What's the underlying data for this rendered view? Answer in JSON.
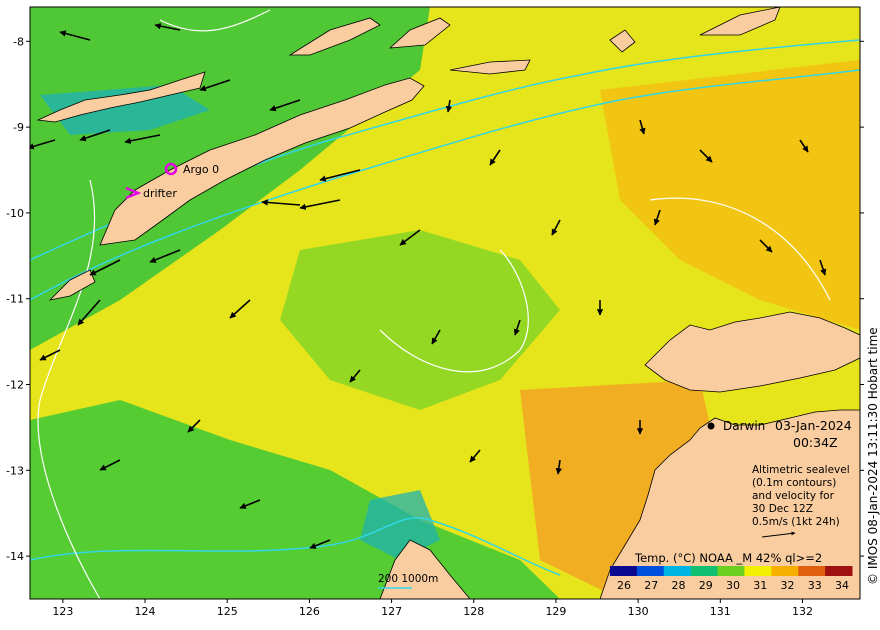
{
  "map": {
    "x_ticks": [
      "123",
      "124",
      "125",
      "126",
      "127",
      "128",
      "129",
      "130",
      "131",
      "132"
    ],
    "y_ticks": [
      "-8",
      "-9",
      "-10",
      "-11",
      "-12",
      "-13",
      "-14"
    ],
    "lon_range": [
      122.6,
      132.7
    ],
    "lat_range": [
      -14.5,
      -7.6
    ],
    "markers": {
      "argo_label": "Argo 0",
      "drifter_label": "drifter"
    },
    "place_label": "Darwin",
    "date_line1": "03-Jan-2024",
    "date_line2": "00:34Z",
    "info": [
      "Altimetric sealevel",
      "(0.1m contours)",
      "and velocity for",
      "30 Dec 12Z",
      "0.5m/s (1kt 24h)"
    ],
    "depth_legend": "200  1000m",
    "credit": "© IMOS 08-Jan-2024 13:11:30 Hobart time",
    "colorbar": {
      "title": "Temp. (°C) NOAA _M 42% ql>=2",
      "ticks": [
        "26",
        "27",
        "28",
        "29",
        "30",
        "31",
        "32",
        "33",
        "34"
      ],
      "colors": [
        "#0a0a90",
        "#0050e0",
        "#00b4e6",
        "#10c070",
        "#6cd020",
        "#f0f000",
        "#f5b000",
        "#e06010",
        "#a01010"
      ]
    },
    "colors": {
      "land": "#f9cda0",
      "sea_mid": "#e6e41a",
      "sea_green": "#2ec23a",
      "sea_orange": "#f4a620",
      "sea_cyan": "#1fb3b0",
      "contour_cyan": "#33d6e6",
      "argo": "#e600e6"
    }
  }
}
